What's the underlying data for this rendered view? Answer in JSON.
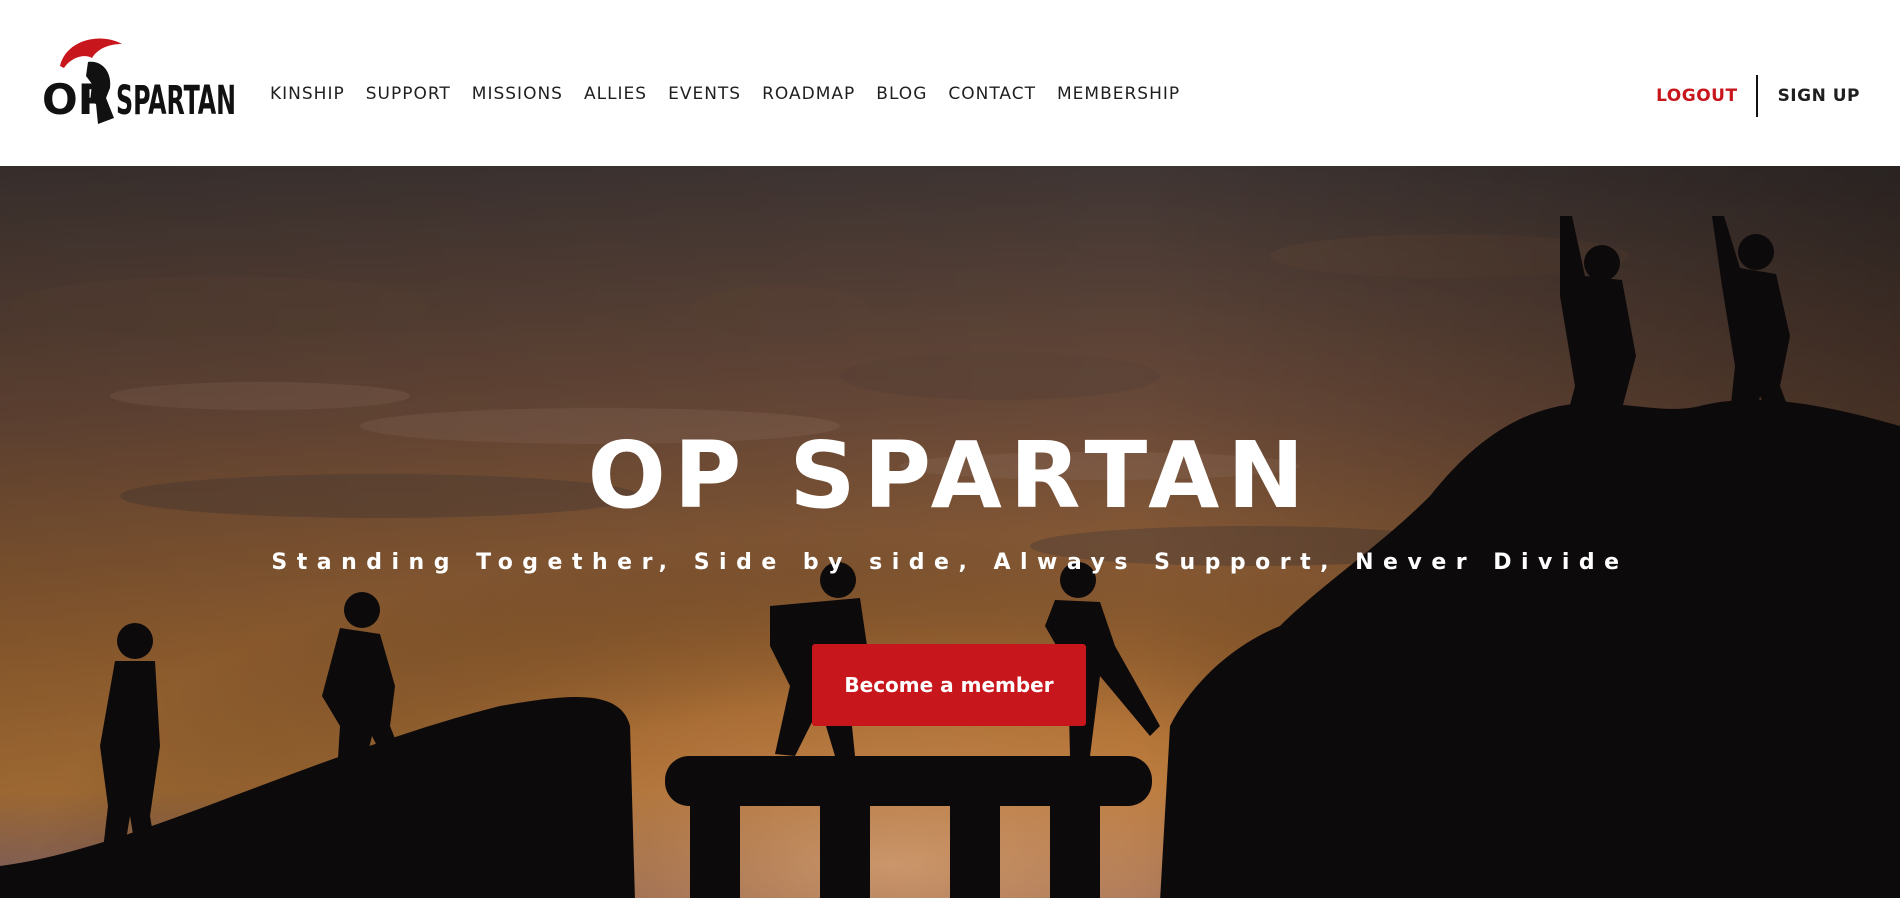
{
  "brand": {
    "logo_text_left": "OP",
    "logo_text_right": "SPARTAN",
    "accent_color": "#c8161d"
  },
  "nav": {
    "items": [
      {
        "label": "KINSHIP"
      },
      {
        "label": "SUPPORT"
      },
      {
        "label": "MISSIONS"
      },
      {
        "label": "ALLIES"
      },
      {
        "label": "EVENTS"
      },
      {
        "label": "ROADMAP"
      },
      {
        "label": "BLOG"
      },
      {
        "label": "CONTACT"
      },
      {
        "label": "MEMBERSHIP"
      }
    ]
  },
  "auth": {
    "logout_label": "LOGOUT",
    "signup_label": "SIGN UP"
  },
  "hero": {
    "title": "OP SPARTAN",
    "subtitle": "Standing Together, Side by side, Always Support, Never Divide",
    "cta_label": "Become a member"
  }
}
